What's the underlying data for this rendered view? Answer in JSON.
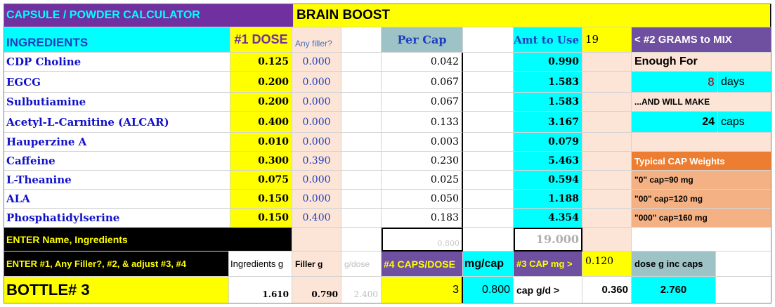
{
  "header": {
    "app_title": "CAPSULE / POWDER CALCULATOR",
    "formula_name": "BRAIN BOOST"
  },
  "columns": {
    "ingredients": "INGREDIENTS",
    "dose": "#1 DOSE",
    "filler": "Any filler?",
    "per_cap": "Per Cap",
    "amt": "Amt to Use",
    "grams_value": "19",
    "grams_label": "< #2 GRAMS to MIX"
  },
  "rows": [
    {
      "name": "CDP Choline",
      "dose": "0.125",
      "filler": "0.000",
      "per_cap": "0.042",
      "amt": "0.990"
    },
    {
      "name": "EGCG",
      "dose": "0.200",
      "filler": "0.000",
      "per_cap": "0.067",
      "amt": "1.583"
    },
    {
      "name": "Sulbutiamine",
      "dose": "0.200",
      "filler": "0.000",
      "per_cap": "0.067",
      "amt": "1.583"
    },
    {
      "name": "Acetyl-L-Carnitine (ALCAR)",
      "dose": "0.400",
      "filler": "0.000",
      "per_cap": "0.133",
      "amt": "3.167"
    },
    {
      "name": "Hauperzine A",
      "dose": "0.010",
      "filler": "0.000",
      "per_cap": "0.003",
      "amt": "0.079"
    },
    {
      "name": "Caffeine",
      "dose": "0.300",
      "filler": "0.390",
      "per_cap": "0.230",
      "amt": "5.463"
    },
    {
      "name": "L-Theanine",
      "dose": "0.075",
      "filler": "0.000",
      "per_cap": "0.025",
      "amt": "0.594"
    },
    {
      "name": "ALA",
      "dose": "0.150",
      "filler": "0.000",
      "per_cap": "0.050",
      "amt": "1.188"
    },
    {
      "name": "Phosphatidylserine",
      "dose": "0.150",
      "filler": "0.400",
      "per_cap": "0.183",
      "amt": "4.354"
    }
  ],
  "side": {
    "enough_for": "Enough For",
    "days_value": "8",
    "days_label": "days",
    "will_make": "...AND WILL MAKE",
    "caps_value": "24",
    "caps_label": "caps",
    "typical_title": "Typical CAP Weights",
    "cap0": "\"0\" cap=90 mg",
    "cap00": "\"00\" cap=120 mg",
    "cap000": "\"000\" cap=160 mg"
  },
  "footer": {
    "enter_name": "ENTER Name, Ingredients",
    "per_cap_total": "0.800",
    "amt_total": "19.000",
    "enter_doses": "ENTER #1, Any Filler?, #2, & adjust #3, #4",
    "ingredients_g_label": "Ingredients g",
    "filler_g_label": "Filler g",
    "g_dose_label": "g/dose",
    "caps_dose_label": "#4 CAPS/DOSE",
    "mg_cap_label": "mg/cap",
    "cap_mg_label": "#3 CAP mg >",
    "cap_mg_value": "0.120",
    "dose_g_label": "dose g inc caps",
    "bottle": "BOTTLE# 3",
    "ingredients_g": "1.610",
    "filler_g": "0.790",
    "g_dose": "2.400",
    "caps_dose": "3",
    "mg_cap": "0.800",
    "cap_gd_label": "cap g/d >",
    "cap_gd": "0.360",
    "dose_g": "2.760"
  }
}
